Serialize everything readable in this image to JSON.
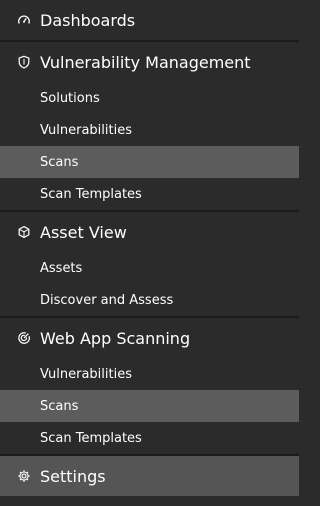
{
  "nav": {
    "dashboards": {
      "label": "Dashboards",
      "icon": "gauge-icon"
    },
    "vuln_mgmt": {
      "label": "Vulnerability Management",
      "icon": "shield-icon",
      "items": [
        {
          "label": "Solutions",
          "active": false
        },
        {
          "label": "Vulnerabilities",
          "active": false
        },
        {
          "label": "Scans",
          "active": true
        },
        {
          "label": "Scan Templates",
          "active": false
        }
      ]
    },
    "asset_view": {
      "label": "Asset View",
      "icon": "cube-icon",
      "items": [
        {
          "label": "Assets",
          "active": false
        },
        {
          "label": "Discover and Assess",
          "active": false
        }
      ]
    },
    "web_app": {
      "label": "Web App Scanning",
      "icon": "radar-icon",
      "items": [
        {
          "label": "Vulnerabilities",
          "active": false
        },
        {
          "label": "Scans",
          "active": true
        },
        {
          "label": "Scan Templates",
          "active": false
        }
      ]
    },
    "settings": {
      "label": "Settings",
      "icon": "gear-icon",
      "active": true
    }
  },
  "colors": {
    "background": "#2b2b2b",
    "active_item": "#5c5c5c",
    "divider": "#1c1c1c",
    "text": "#ffffff"
  }
}
